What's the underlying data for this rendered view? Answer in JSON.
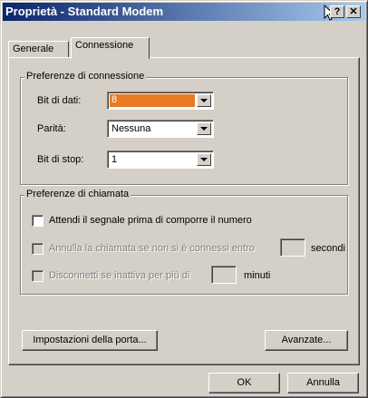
{
  "window": {
    "title": "Proprietà - Standard Modem",
    "help_label": "?",
    "close_label": "✕"
  },
  "tabs": [
    {
      "label": "Generale"
    },
    {
      "label": "Connessione"
    }
  ],
  "connection_prefs": {
    "title": "Preferenze di connessione",
    "data_bits_label": "Bit di dati:",
    "data_bits_value": "8",
    "parity_label": "Parità:",
    "parity_value": "Nessuna",
    "stop_bits_label": "Bit di stop:",
    "stop_bits_value": "1"
  },
  "call_prefs": {
    "title": "Preferenze di chiamata",
    "wait_dial_tone": "Attendi il segnale prima di comporre il numero",
    "cancel_call": "Annulla la chiamata se non si è connessi entro",
    "cancel_call_unit": "secondi",
    "disconnect_idle": "Disconnetti se inattiva per più di",
    "disconnect_unit": "minuti"
  },
  "buttons": {
    "port_settings": "Impostazioni della porta...",
    "advanced": "Avanzate...",
    "ok": "OK",
    "cancel": "Annulla"
  }
}
